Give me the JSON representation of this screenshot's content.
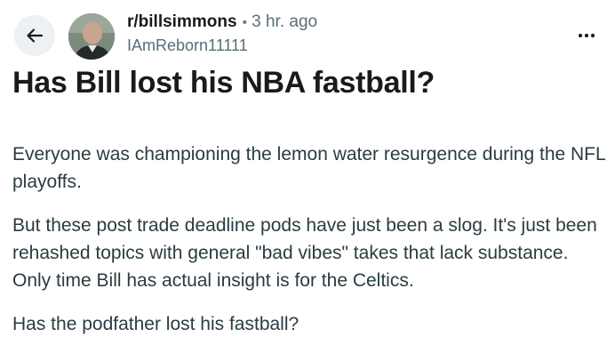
{
  "header": {
    "subreddit": "r/billsimmons",
    "separator": "•",
    "time": "3 hr. ago",
    "username": "IAmReborn11111"
  },
  "post": {
    "title": "Has Bill lost his NBA fastball?",
    "paragraphs": [
      "Everyone was championing the lemon water resurgence during the NFL playoffs.",
      "But these post trade deadline pods have just been a slog. It's just been rehashed topics with general \"bad vibes\" takes that lack substance. Only time Bill has actual insight is for the Celtics.",
      "Has the podfather lost his fastball?"
    ]
  },
  "icons": {
    "back": "arrow-left-icon",
    "more": "more-horizontal-icon",
    "avatar": "user-avatar-photo"
  },
  "colors": {
    "back_button_bg": "#eef1f3",
    "title": "#1a1a1b",
    "body_text": "#2a3c42",
    "meta_text": "#576f76"
  }
}
